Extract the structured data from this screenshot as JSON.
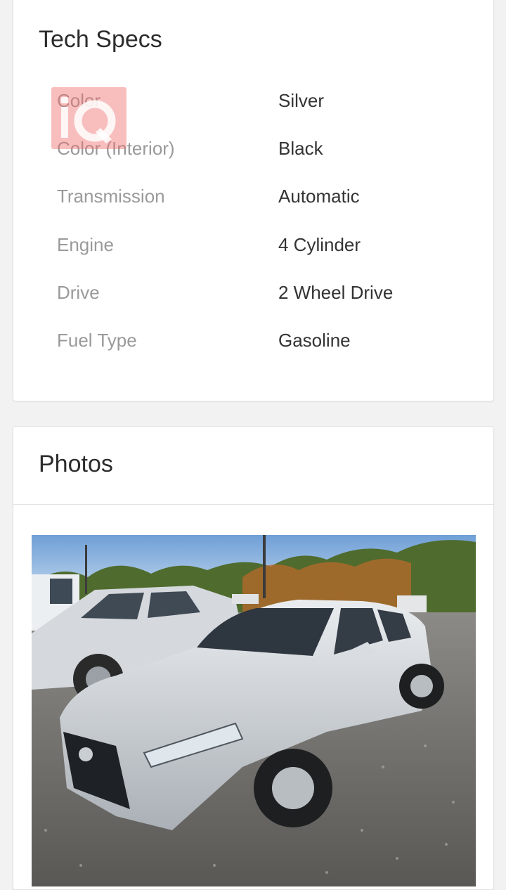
{
  "tech_specs": {
    "title": "Tech Specs",
    "rows": [
      {
        "label": "Color",
        "value": "Silver"
      },
      {
        "label": "Color (Interior)",
        "value": "Black"
      },
      {
        "label": "Transmission",
        "value": "Automatic"
      },
      {
        "label": "Engine",
        "value": "4 Cylinder"
      },
      {
        "label": "Drive",
        "value": "2 Wheel Drive"
      },
      {
        "label": "Fuel Type",
        "value": "Gasoline"
      }
    ]
  },
  "photos": {
    "title": "Photos",
    "image_description": "silver sedan parked on gravel lot"
  },
  "colors": {
    "label": "#9a9a9a",
    "value": "#333333",
    "background": "#f2f2f2",
    "watermark": "#f06e6e"
  }
}
